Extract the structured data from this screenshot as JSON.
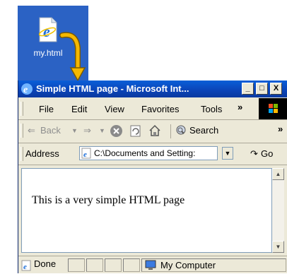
{
  "desktop": {
    "file_icon": "ie-html-file-icon",
    "file_name": "my.html",
    "background_color": "#2b62c4",
    "arrow_color": "#f5b800"
  },
  "window": {
    "title": "Simple HTML page - Microsoft Int...",
    "controls": {
      "minimize": "_",
      "maximize": "□",
      "close": "X"
    }
  },
  "menu": {
    "items": [
      "File",
      "Edit",
      "View",
      "Favorites",
      "Tools"
    ],
    "overflow": "»"
  },
  "toolbar": {
    "back": "Back",
    "search": "Search",
    "overflow": "»"
  },
  "address": {
    "label": "Address",
    "value": "C:\\Documents and Setting:",
    "go": "Go"
  },
  "page": {
    "body_text": "This is a very simple HTML page"
  },
  "status": {
    "done": "Done",
    "zone": "My Computer"
  }
}
